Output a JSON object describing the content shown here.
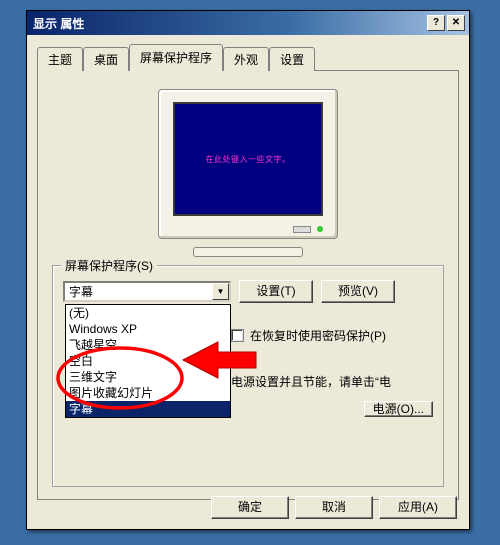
{
  "titlebar": {
    "title": "显示 属性",
    "help_glyph": "?",
    "close_glyph": "✕"
  },
  "tabs": {
    "theme": "主题",
    "desktop": "桌面",
    "screensaver": "屏幕保护程序",
    "appearance": "外观",
    "settings": "设置"
  },
  "preview": {
    "marquee_text": "在此处键入一些文字。"
  },
  "group_label": "屏幕保护程序(S)",
  "combo": {
    "selected": "字幕",
    "options": [
      "(无)",
      "Windows XP",
      "飞越星空",
      "空白",
      "三维文字",
      "图片收藏幻灯片",
      "字幕"
    ]
  },
  "buttons": {
    "settings": "设置(T)",
    "preview": "预览(V)",
    "power": "电源(O)...",
    "ok": "确定",
    "cancel": "取消",
    "apply": "应用(A)"
  },
  "labels": {
    "wait_part_visible": "",
    "password_check": "在恢复时使用密码保护(P)",
    "power_hint": "电源设置并且节能，请单击“电"
  },
  "annotation": {
    "color": "#ff0000"
  }
}
